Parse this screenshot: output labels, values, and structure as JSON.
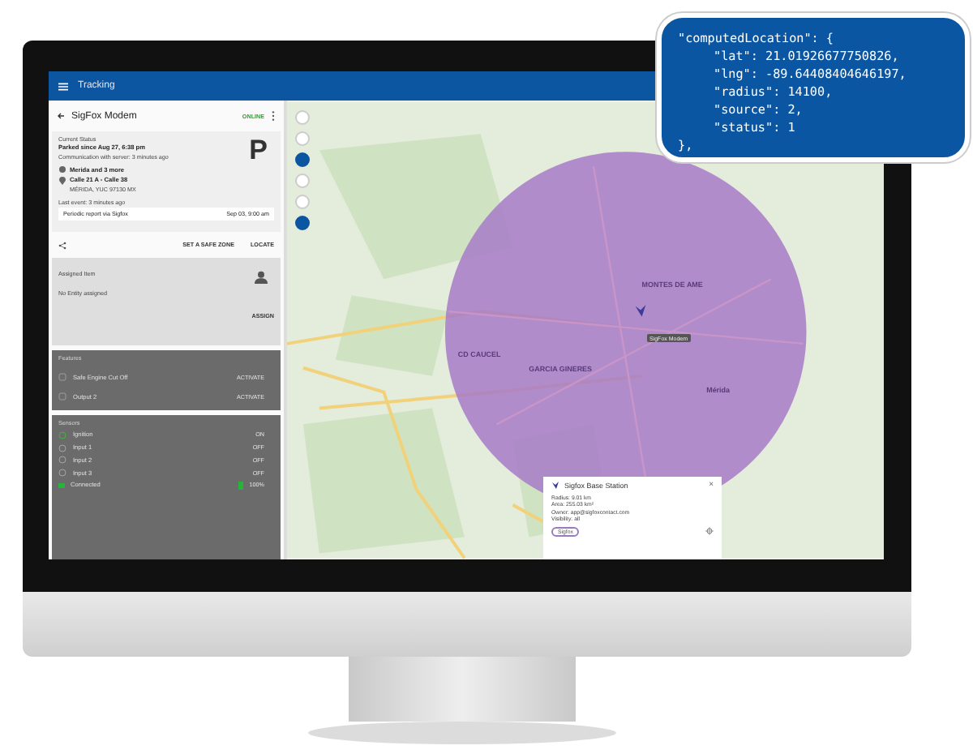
{
  "callout": {
    "lines": [
      {
        "text": "\"computedLocation\": {",
        "indented": false
      },
      {
        "text": "\"lat\": 21.01926677750826,",
        "indented": true
      },
      {
        "text": "\"lng\": -89.64408404646197,",
        "indented": true
      },
      {
        "text": "\"radius\": 14100,",
        "indented": true
      },
      {
        "text": "\"source\": 2,",
        "indented": true
      },
      {
        "text": "\"status\": 1",
        "indented": true
      },
      {
        "text": "},",
        "indented": false
      }
    ]
  },
  "app_bar": {
    "title": "Tracking"
  },
  "device": {
    "name": "SigFox Modem",
    "status": "ONLINE"
  },
  "current_status": {
    "heading": "Current Status",
    "state": "Parked since Aug 27, 6:38 pm",
    "communication": "Communication with server: 3 minutes ago",
    "badge": "P",
    "location": "Merida and 3 more",
    "street": "Calle 21 A - Calle 38",
    "city": "MÉRIDA, YUC 97130 MX",
    "last_event": "Last event: 3 minutes ago",
    "report": "Periodic report via Sigfox",
    "report_time": "Sep 03, 9:00 am"
  },
  "actions": [
    "SET A SAFE ZONE",
    "LOCATE"
  ],
  "assigned": {
    "heading": "Assigned Item",
    "text": "No Entity assigned",
    "action": "ASSIGN"
  },
  "features": {
    "heading": "Features",
    "items": [
      {
        "label": "Safe Engine Cut Off",
        "action": "ACTIVATE"
      },
      {
        "label": "Output 2",
        "action": "ACTIVATE"
      }
    ]
  },
  "sensors": {
    "heading": "Sensors",
    "items": [
      {
        "label": "Ignition",
        "value": "ON",
        "on": true
      },
      {
        "label": "Input 1",
        "value": "OFF",
        "on": false
      },
      {
        "label": "Input 2",
        "value": "OFF",
        "on": false
      },
      {
        "label": "Input 3",
        "value": "OFF",
        "on": false
      }
    ],
    "connection": "Connected",
    "battery": "100%"
  },
  "map": {
    "controls": [
      {
        "active": false
      },
      {
        "active": false
      },
      {
        "active": true
      },
      {
        "active": false
      },
      {
        "active": false
      },
      {
        "active": true
      }
    ],
    "labels": [
      {
        "text": "CD CAUCEL"
      },
      {
        "text": "GARCIA GINERES"
      },
      {
        "text": "Mérida"
      },
      {
        "text": "MONTES DE AME"
      }
    ],
    "marker_label": "SigFox Modem",
    "popup": {
      "title": "Sigfox Base Station",
      "details": [
        "Radius: 9.01 km",
        "Area: 255.03 km²",
        "Owner: app@sigfoxcontact.com",
        "Visibility: all"
      ],
      "tag": "Sigfox",
      "close": "×"
    }
  }
}
